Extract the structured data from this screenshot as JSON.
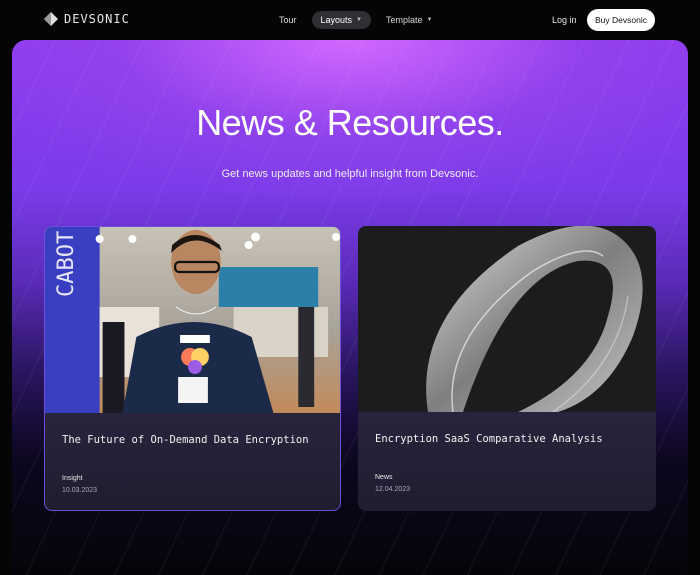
{
  "nav": {
    "brand": "DEVSONIC",
    "menu": [
      {
        "label": "Tour"
      },
      {
        "label": "Layouts"
      },
      {
        "label": "Template"
      }
    ],
    "login_label": "Log in",
    "buy_label": "Buy Devsonic"
  },
  "hero": {
    "title": "News & Resources.",
    "subtitle": "Get news updates and helpful insight from Devsonic."
  },
  "cards": [
    {
      "title": "The Future of On-Demand Data Encryption",
      "tag": "Insight",
      "date": "10.03.2023"
    },
    {
      "title": "Encryption SaaS Comparative Analysis",
      "tag": "News",
      "date": "12.04.2023"
    }
  ],
  "colors": {
    "accent": "#8f3cf0",
    "background": "#050505",
    "card_border": "#6b4fd8"
  }
}
